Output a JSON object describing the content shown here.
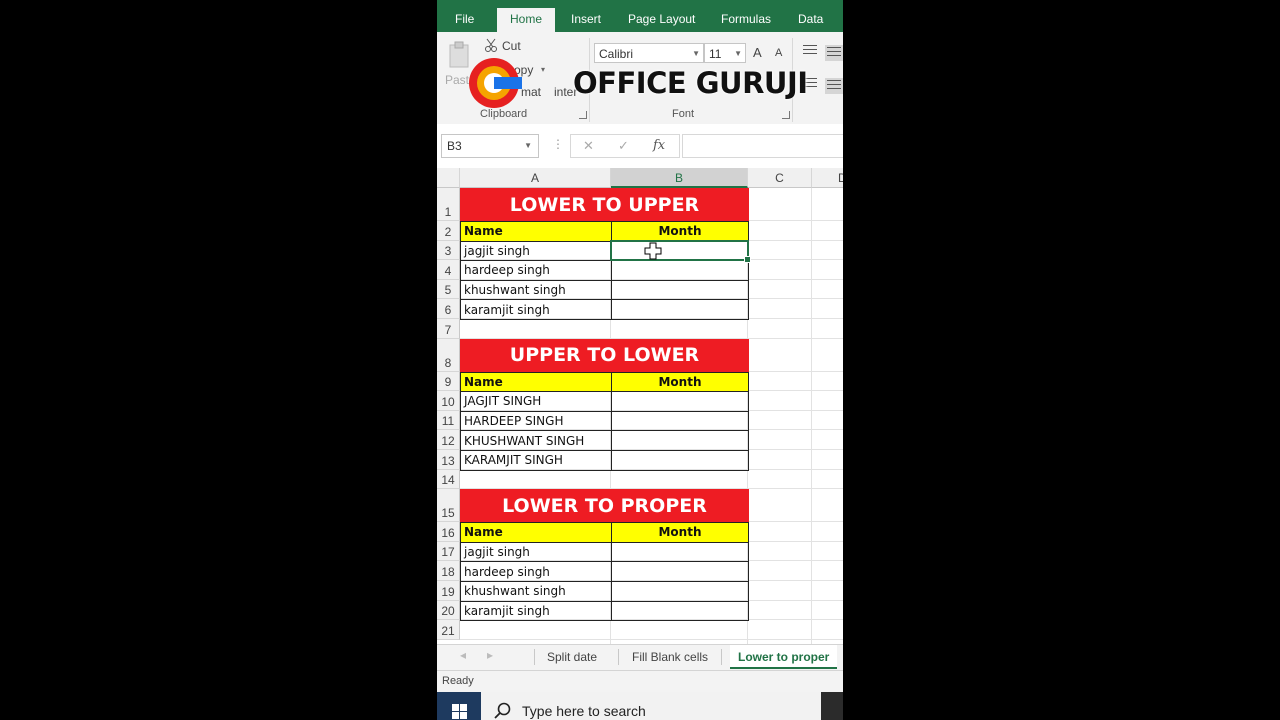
{
  "ribbon": {
    "tabs": [
      "File",
      "Home",
      "Insert",
      "Page Layout",
      "Formulas",
      "Data"
    ],
    "active_tab": "Home",
    "clipboard": {
      "cut": "Cut",
      "copy": "opy",
      "paste": "Past",
      "format": "mat",
      "painter": "inter",
      "group_label": "Clipboard"
    },
    "font": {
      "name": "Calibri",
      "size": "11",
      "grow": "A",
      "shrink": "A",
      "group_label": "Font"
    }
  },
  "logo": {
    "text": "OFFICE GURUJI",
    "colors": [
      "#e62020",
      "#f5a400",
      "#1a73e8"
    ]
  },
  "formula_bar": {
    "name_box": "B3",
    "cancel": "✕",
    "enter": "✓",
    "fx": "fx",
    "value": ""
  },
  "columns": [
    "A",
    "B",
    "C",
    "D"
  ],
  "selected_column": "B",
  "selected_cell": "B3",
  "sections": [
    {
      "title": "LOWER TO UPPER",
      "header_name": "Name",
      "header_month": "Month",
      "names": [
        "jagjit singh",
        "hardeep singh",
        "khushwant singh",
        "karamjit singh"
      ]
    },
    {
      "title": "UPPER TO LOWER",
      "header_name": "Name",
      "header_month": "Month",
      "names": [
        "JAGJIT SINGH",
        "HARDEEP SINGH",
        "KHUSHWANT SINGH",
        "KARAMJIT SINGH"
      ]
    },
    {
      "title": "LOWER TO PROPER",
      "header_name": "Name",
      "header_month": "Month",
      "names": [
        "jagjit singh",
        "hardeep singh",
        "khushwant singh",
        "karamjit singh"
      ]
    }
  ],
  "row_numbers": [
    "1",
    "2",
    "3",
    "4",
    "5",
    "6",
    "7",
    "8",
    "9",
    "10",
    "11",
    "12",
    "13",
    "14",
    "15",
    "16",
    "17",
    "18",
    "19",
    "20",
    "21"
  ],
  "sheet_tabs": [
    "Split date",
    "Fill Blank cells",
    "Lower to proper"
  ],
  "active_sheet": "Lower to proper",
  "status": "Ready",
  "taskbar": {
    "search_placeholder": "Type here to search"
  },
  "colors": {
    "excel_green": "#217346",
    "title_red": "#ee1c23",
    "header_yellow": "#ffff00"
  }
}
